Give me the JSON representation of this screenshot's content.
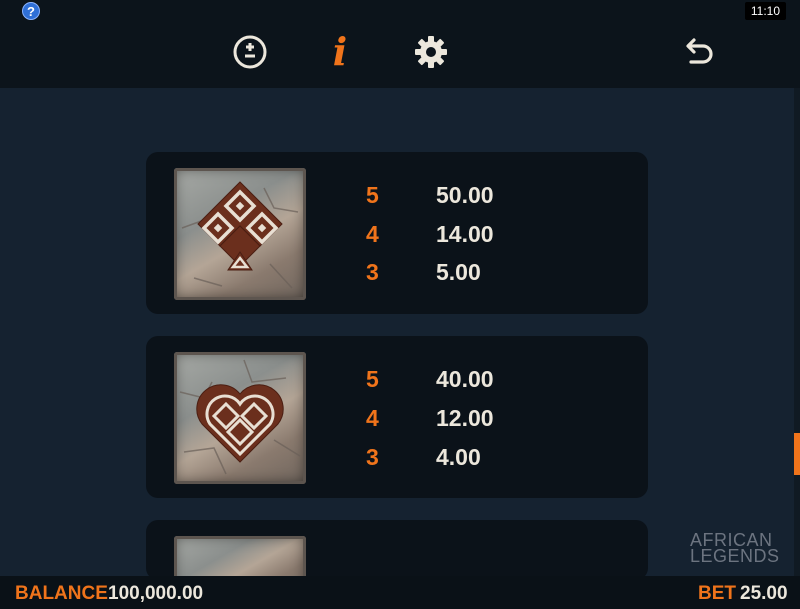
{
  "topbar": {
    "help_badge": "?",
    "clock": "11:10",
    "icons": [
      "bet-adjust-icon",
      "info-icon",
      "gear-icon",
      "back-arrow-icon"
    ],
    "info_glyph": "i"
  },
  "paytable": [
    {
      "symbol": "diamond-symbol",
      "rows": [
        {
          "count": "5",
          "value": "50.00"
        },
        {
          "count": "4",
          "value": "14.00"
        },
        {
          "count": "3",
          "value": "5.00"
        }
      ]
    },
    {
      "symbol": "heart-symbol",
      "rows": [
        {
          "count": "5",
          "value": "40.00"
        },
        {
          "count": "4",
          "value": "12.00"
        },
        {
          "count": "3",
          "value": "4.00"
        }
      ]
    }
  ],
  "brand": {
    "line1": "AFRICAN",
    "line2": "LEGENDS"
  },
  "footer": {
    "balance_label": "BALANCE",
    "balance_value": "100,000.00",
    "bet_label": "BET",
    "bet_value": "25.00"
  },
  "colors": {
    "accent": "#f0741b",
    "background": "#152230",
    "card": "#0b1219"
  },
  "scroll_position": 0.72
}
